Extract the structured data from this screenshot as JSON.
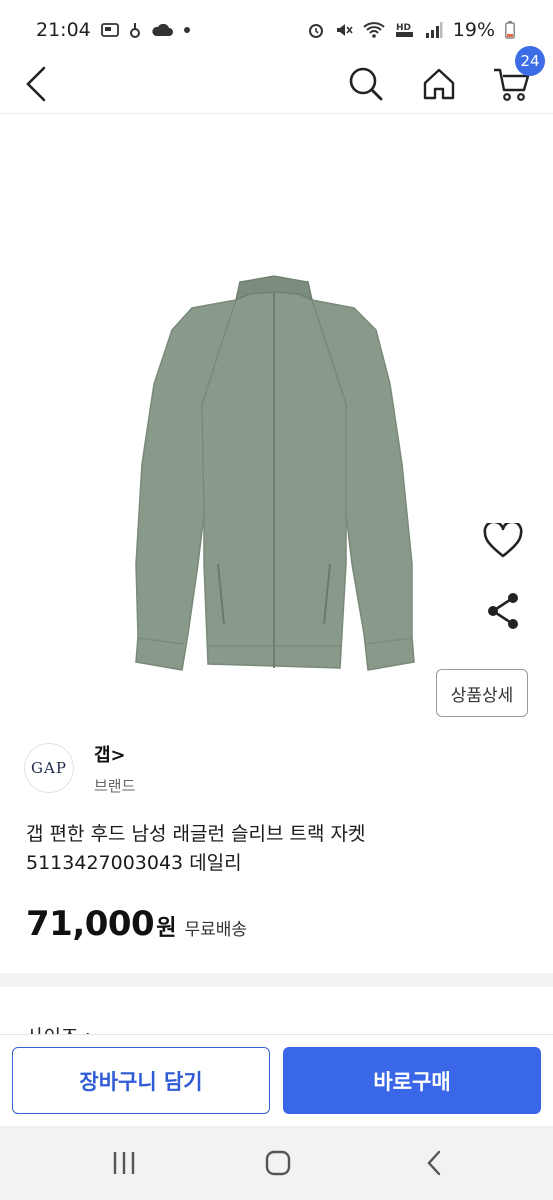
{
  "status_bar": {
    "time": "21:04",
    "battery": "19%"
  },
  "header": {
    "cart_count": "24",
    "icons": [
      "back-arrow-icon",
      "search-icon",
      "home-icon",
      "cart-icon"
    ]
  },
  "product": {
    "detail_button": "상품상세",
    "brand_logo": "GAP",
    "brand_name": "갭>",
    "brand_sub": "브랜드",
    "title_line1": "갭 편한 후드 남성 래글런 슬리브 트랙 자켓",
    "title_line2": "5113427003043 데일리",
    "price": "71,000",
    "price_unit": "원",
    "shipping": "무료배송",
    "image_color": "#8a9a8a"
  },
  "next_section": {
    "label": "사이즈 :"
  },
  "actions": {
    "add_to_cart": "장바구니 담기",
    "buy_now": "바로구매"
  },
  "colors": {
    "accent": "#3a67e8",
    "badge": "#3c6ce6"
  }
}
